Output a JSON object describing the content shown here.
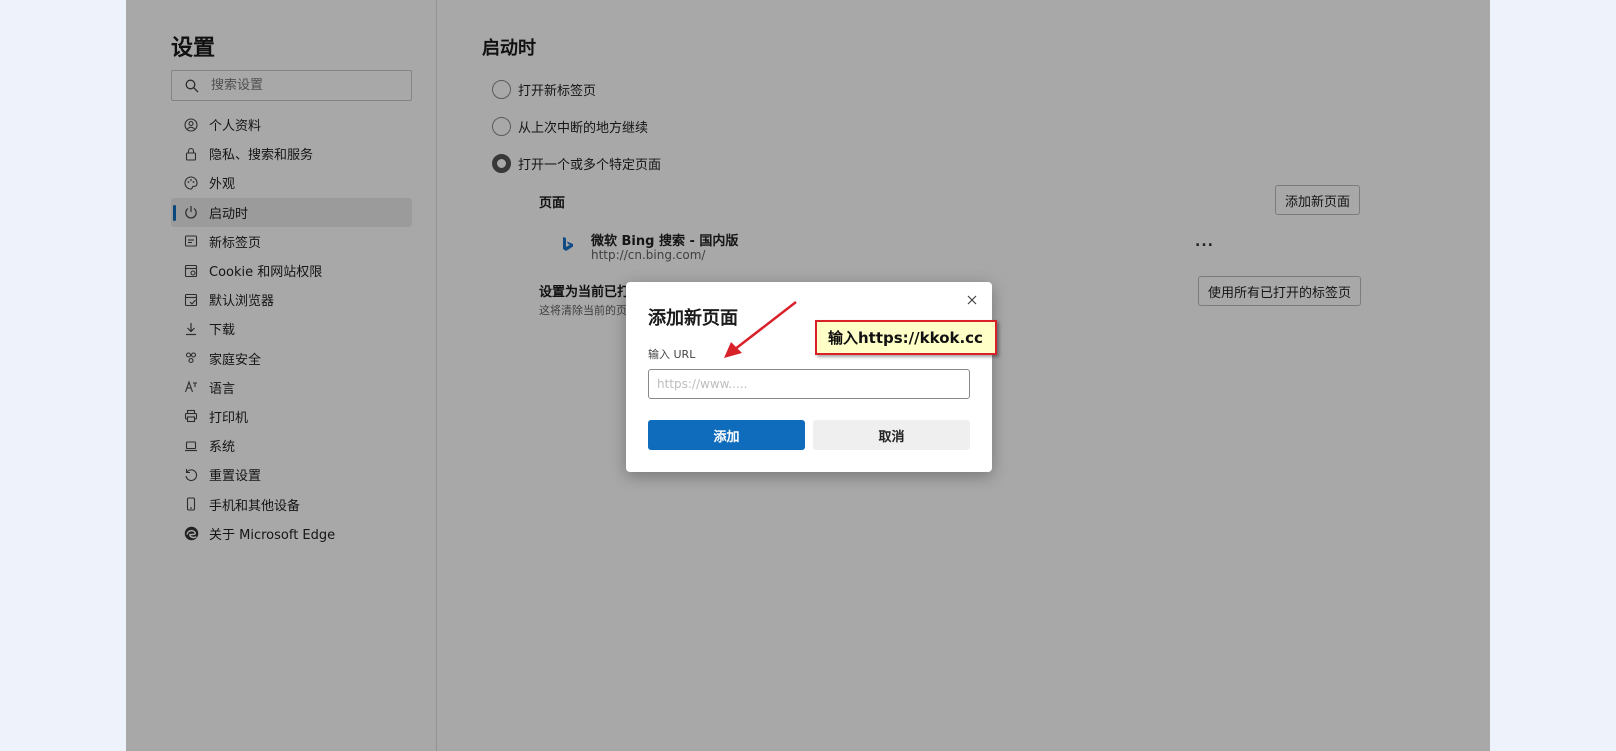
{
  "sidebar": {
    "title": "设置",
    "search_placeholder": "搜索设置",
    "items": [
      {
        "label": "个人资料",
        "icon": "profile-icon"
      },
      {
        "label": "隐私、搜索和服务",
        "icon": "lock-icon"
      },
      {
        "label": "外观",
        "icon": "palette-icon"
      },
      {
        "label": "启动时",
        "icon": "power-icon",
        "active": true
      },
      {
        "label": "新标签页",
        "icon": "new-tab-icon"
      },
      {
        "label": "Cookie 和网站权限",
        "icon": "site-permissions-icon"
      },
      {
        "label": "默认浏览器",
        "icon": "default-browser-icon"
      },
      {
        "label": "下载",
        "icon": "download-icon"
      },
      {
        "label": "家庭安全",
        "icon": "family-icon"
      },
      {
        "label": "语言",
        "icon": "language-icon"
      },
      {
        "label": "打印机",
        "icon": "printer-icon"
      },
      {
        "label": "系统",
        "icon": "laptop-icon"
      },
      {
        "label": "重置设置",
        "icon": "reset-icon"
      },
      {
        "label": "手机和其他设备",
        "icon": "phone-icon"
      },
      {
        "label": "关于 Microsoft Edge",
        "icon": "edge-logo-icon"
      }
    ]
  },
  "main": {
    "title": "启动时",
    "options": [
      {
        "label": "打开新标签页",
        "checked": false
      },
      {
        "label": "从上次中断的地方继续",
        "checked": false
      },
      {
        "label": "打开一个或多个特定页面",
        "checked": true
      }
    ],
    "pages_label": "页面",
    "add_page_button": "添加新页面",
    "page_entry": {
      "title": "微软 Bing 搜索 - 国内版",
      "url": "http://cn.bing.com/",
      "more": "..."
    },
    "set_current_title": "设置为当前已打",
    "set_current_desc": "这将清除当前的页",
    "use_all_tabs_button": "使用所有已打开的标签页"
  },
  "dialog": {
    "title": "添加新页面",
    "close": "×",
    "url_label": "输入 URL",
    "url_placeholder": "https://www.....",
    "add_button": "添加",
    "cancel_button": "取消"
  },
  "callout": {
    "text": "输入https://kkok.cc"
  },
  "colors": {
    "accent": "#0f6cbd",
    "callout_border": "#d9212a",
    "callout_bg": "#ffffc8",
    "arrow": "#d9212a"
  }
}
